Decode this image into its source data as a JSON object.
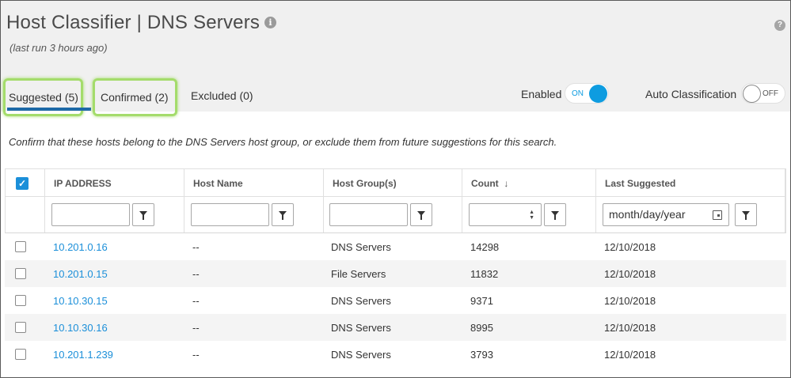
{
  "page": {
    "title": "Host Classifier | DNS Servers",
    "info_icon": "info-icon",
    "help_icon": "help-icon",
    "subtitle": "(last run 3 hours ago)"
  },
  "tabs": [
    {
      "label": "Suggested (5)",
      "active": true
    },
    {
      "label": "Confirmed (2)",
      "active": false
    },
    {
      "label": "Excluded (0)",
      "active": false
    }
  ],
  "toggles": {
    "enabled": {
      "label": "Enabled",
      "state": "ON",
      "on": true
    },
    "auto": {
      "label": "Auto Classification",
      "state": "OFF",
      "on": false
    }
  },
  "description": "Confirm that these hosts belong to the DNS Servers host group, or exclude them from future suggestions for this search.",
  "table": {
    "columns": [
      "IP ADDRESS",
      "Host Name",
      "Host Group(s)",
      "Count",
      "Last Suggested"
    ],
    "sort_indicator": "↓",
    "date_placeholder": "month/day/year",
    "rows": [
      {
        "ip": "10.201.0.16",
        "host": "--",
        "group": "DNS Servers",
        "count": "14298",
        "last": "12/10/2018"
      },
      {
        "ip": "10.201.0.15",
        "host": "--",
        "group": "File Servers",
        "count": "11832",
        "last": "12/10/2018"
      },
      {
        "ip": "10.10.30.15",
        "host": "--",
        "group": "DNS Servers",
        "count": "9371",
        "last": "12/10/2018"
      },
      {
        "ip": "10.10.30.16",
        "host": "--",
        "group": "DNS Servers",
        "count": "8995",
        "last": "12/10/2018"
      },
      {
        "ip": "10.201.1.239",
        "host": "--",
        "group": "DNS Servers",
        "count": "3793",
        "last": "12/10/2018"
      }
    ]
  },
  "colors": {
    "accent": "#1b8fd9",
    "toggle_on": "#0e9ce0",
    "tab_underline": "#1d69a7",
    "highlight": "#a4dc6b"
  }
}
